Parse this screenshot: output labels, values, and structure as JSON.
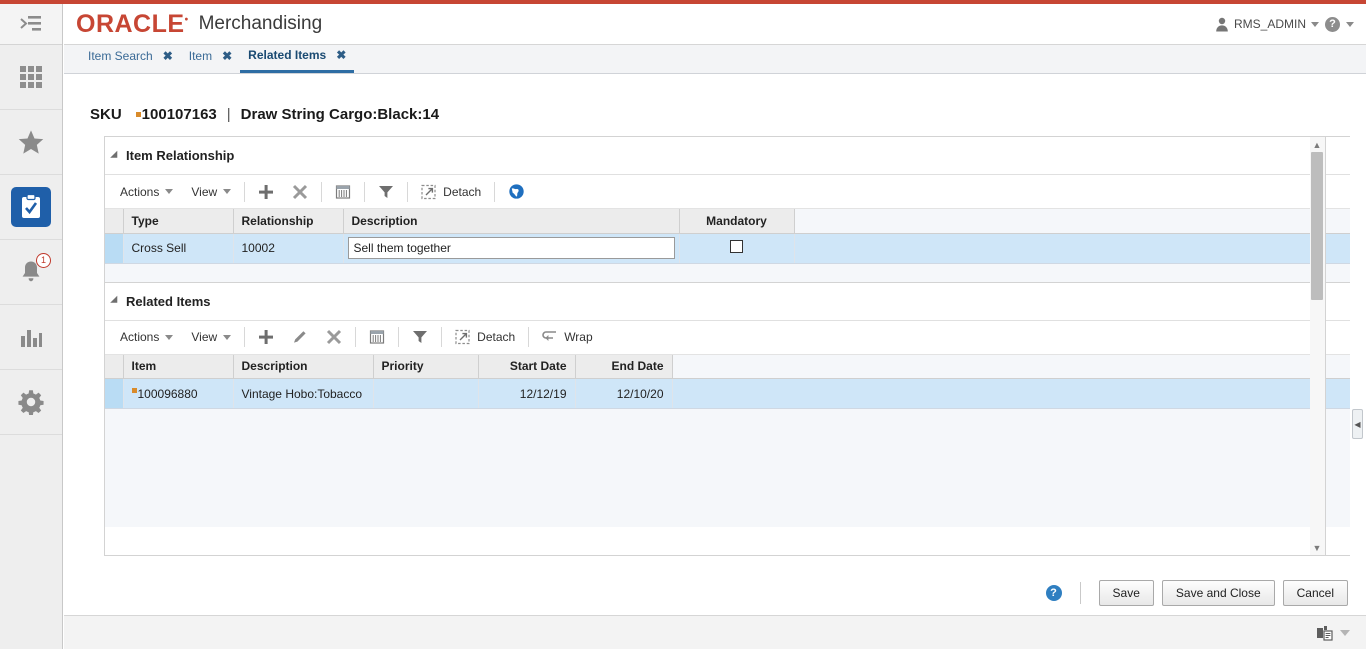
{
  "brand": {
    "logo_text": "ORACLE",
    "app_name": "Merchandising",
    "accent_red": "#c74634",
    "accent_blue": "#1f5fa9"
  },
  "header": {
    "user_name": "RMS_ADMIN",
    "user_icon": "user-icon",
    "help_icon": "help-icon",
    "menu_toggle_icon": "menu-collapse-icon"
  },
  "sidebar": {
    "items": [
      {
        "icon": "apps-grid-icon",
        "active": false,
        "badge": ""
      },
      {
        "icon": "star-favorites-icon",
        "active": false,
        "badge": ""
      },
      {
        "icon": "tasks-clipboard-icon",
        "active": true,
        "badge": ""
      },
      {
        "icon": "notifications-bell-icon",
        "active": false,
        "badge": "1"
      },
      {
        "icon": "reports-bar-chart-icon",
        "active": false,
        "badge": ""
      },
      {
        "icon": "settings-gear-icon",
        "active": false,
        "badge": ""
      }
    ]
  },
  "tabs": [
    {
      "label": "Item Search",
      "active": false,
      "close": "✖"
    },
    {
      "label": "Item",
      "active": false,
      "close": "✖"
    },
    {
      "label": "Related Items",
      "active": true,
      "close": "✖"
    }
  ],
  "page": {
    "sku_label": "SKU",
    "sku_value": "100107163",
    "separator": "|",
    "sku_description": "Draw String Cargo:Black:14"
  },
  "item_relationship": {
    "title": "Item Relationship",
    "toolbar": {
      "actions": "Actions",
      "view": "View",
      "add_icon": "add-plus-icon",
      "delete_icon": "delete-x-icon",
      "export_icon": "export-spreadsheet-icon",
      "filter_icon": "filter-funnel-icon",
      "detach": "Detach",
      "detach_icon": "detach-icon",
      "translate_icon": "globe-translate-icon"
    },
    "columns": [
      "Type",
      "Relationship",
      "Description",
      "Mandatory"
    ],
    "rows": [
      {
        "type": "Cross Sell",
        "relationship": "10002",
        "description": "Sell them together",
        "mandatory": false
      }
    ]
  },
  "related_items": {
    "title": "Related Items",
    "toolbar": {
      "actions": "Actions",
      "view": "View",
      "add_icon": "add-plus-icon",
      "edit_icon": "edit-pencil-icon",
      "delete_icon": "delete-x-icon",
      "export_icon": "export-spreadsheet-icon",
      "filter_icon": "filter-funnel-icon",
      "detach": "Detach",
      "detach_icon": "detach-icon",
      "wrap": "Wrap",
      "wrap_icon": "wrap-icon"
    },
    "columns": [
      "Item",
      "Description",
      "Priority",
      "Start Date",
      "End Date"
    ],
    "rows": [
      {
        "item": "100096880",
        "description": "Vintage Hobo:Tobacco",
        "priority": "",
        "start_date": "12/12/19",
        "end_date": "12/10/20"
      }
    ]
  },
  "footer": {
    "help_icon": "help-question-icon",
    "save": "Save",
    "save_and_close": "Save and Close",
    "cancel": "Cancel"
  },
  "statusbar": {
    "printer_icon": "printer-device-icon"
  }
}
